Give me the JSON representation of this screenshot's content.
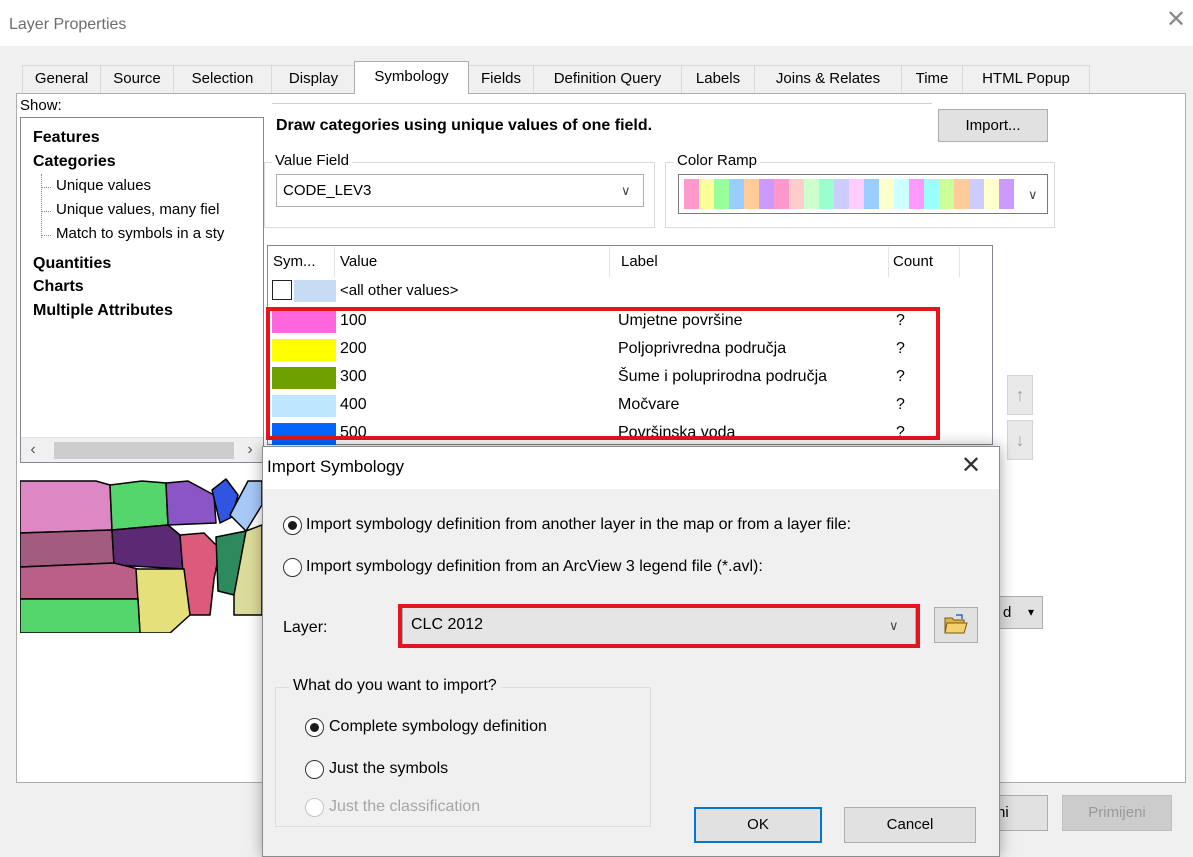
{
  "window": {
    "title": "Layer Properties",
    "close": "✕"
  },
  "tabs": [
    {
      "label": "General"
    },
    {
      "label": "Source"
    },
    {
      "label": "Selection"
    },
    {
      "label": "Display"
    },
    {
      "label": "Symbology",
      "active": true
    },
    {
      "label": "Fields"
    },
    {
      "label": "Definition Query"
    },
    {
      "label": "Labels"
    },
    {
      "label": "Joins & Relates"
    },
    {
      "label": "Time"
    },
    {
      "label": "HTML Popup"
    }
  ],
  "show": {
    "label": "Show:",
    "tree": {
      "features": "Features",
      "categories": "Categories",
      "unique_values": "Unique values",
      "unique_values_many": "Unique values, many fiel",
      "match_symbols": "Match to symbols in a sty",
      "quantities": "Quantities",
      "charts": "Charts",
      "multiple_attributes": "Multiple Attributes"
    }
  },
  "symbology": {
    "description": "Draw categories using unique values of one field.",
    "import_button": "Import...",
    "value_field_label": "Value Field",
    "value_field_value": "CODE_LEV3",
    "color_ramp_label": "Color Ramp",
    "ramp_colors": [
      "#ff99cc",
      "#ffff99",
      "#99ff99",
      "#99ccff",
      "#ffcc99",
      "#cc99ff",
      "#ff99cc",
      "#ffcccc",
      "#ccffcc",
      "#99ffcc",
      "#ccccff",
      "#ffccff",
      "#99ccff",
      "#ffffcc",
      "#ccffff",
      "#ff99ff",
      "#99ffff",
      "#ccff99",
      "#ffcc99",
      "#ccccff",
      "#ffffcc",
      "#cc99ff"
    ]
  },
  "values_table": {
    "headers": {
      "symbol": "Sym...",
      "value": "Value",
      "label": "Label",
      "count": "Count"
    },
    "other": {
      "value": "<all other values>",
      "color": "#c6dcf4"
    },
    "rows": [
      {
        "value": "100",
        "label": "Umjetne površine",
        "count": "?",
        "color": "#ff66dd"
      },
      {
        "value": "200",
        "label": "Poljoprivredna područja",
        "count": "?",
        "color": "#ffff00"
      },
      {
        "value": "300",
        "label": "Šume i poluprirodna područja",
        "count": "?",
        "color": "#6ea000"
      },
      {
        "value": "400",
        "label": "Močvare",
        "count": "?",
        "color": "#bfe6ff"
      },
      {
        "value": "500",
        "label": "Površinska voda",
        "count": "?",
        "color": "#0066ff"
      }
    ]
  },
  "behind": {
    "dropdown_text": "d",
    "ok_partial": "ni",
    "apply": "Primijeni"
  },
  "import_dialog": {
    "title": "Import Symbology",
    "close": "✕",
    "option_layer": "Import symbology definition from another layer in the map or from a layer file:",
    "option_avl": "Import symbology definition from an ArcView 3 legend file (*.avl):",
    "layer_label": "Layer:",
    "layer_value": "CLC 2012",
    "what_label": "What do you want to import?",
    "complete": "Complete symbology definition",
    "just_symbols": "Just the symbols",
    "just_classification": "Just the classification",
    "ok": "OK",
    "cancel": "Cancel"
  },
  "colors": {
    "highlight": "#e5141d",
    "accent": "#0078d7"
  }
}
